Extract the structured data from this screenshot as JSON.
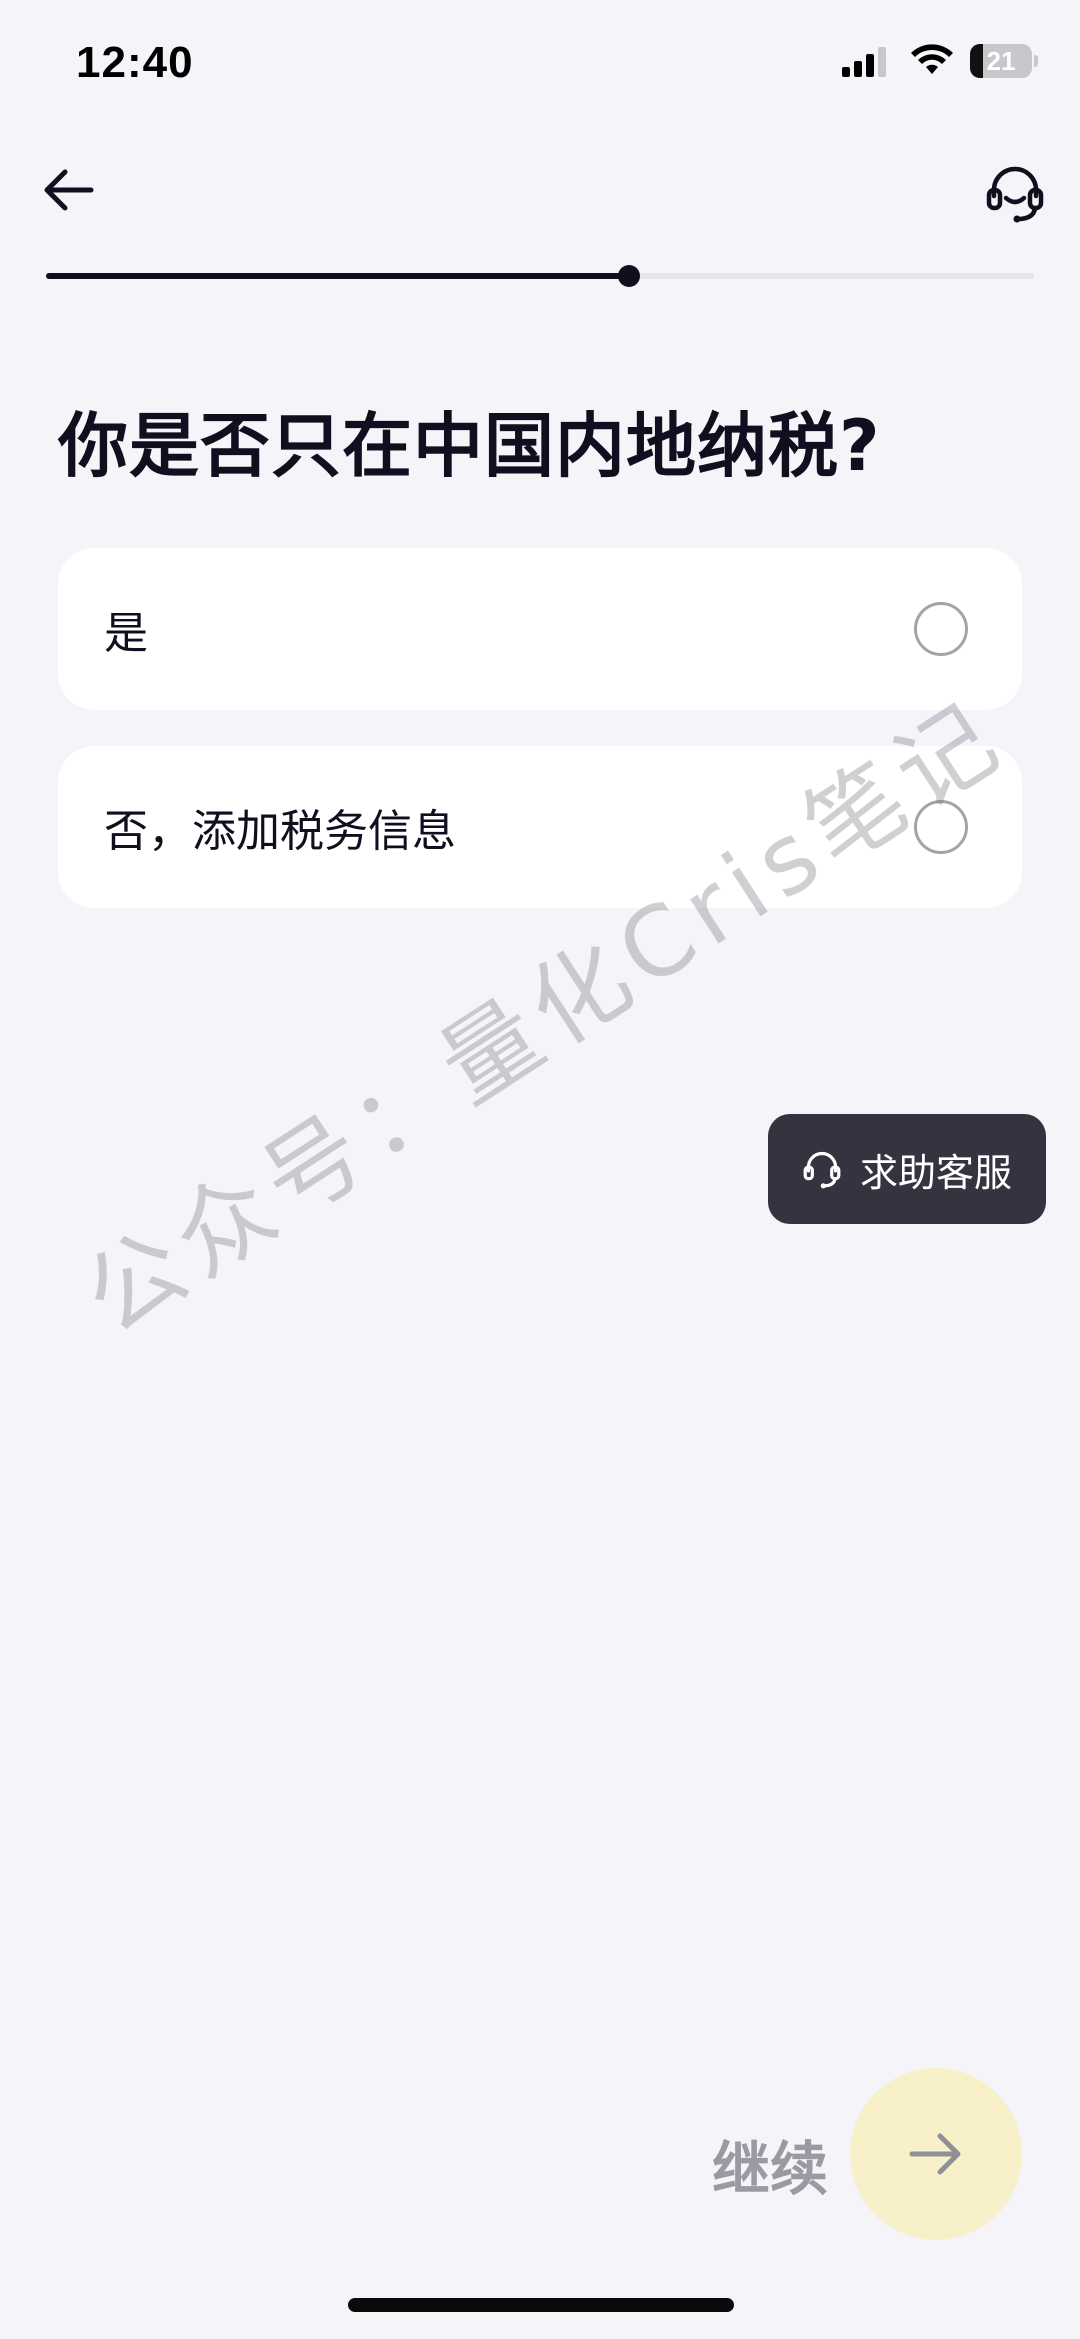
{
  "status_bar": {
    "time": "12:40",
    "battery": "21",
    "battery_level": 0.21
  },
  "nav": {
    "back_icon": "arrow-left-icon",
    "support_icon": "headset-icon"
  },
  "progress": {
    "value": 0.59
  },
  "question": {
    "title": "你是否只在中国内地纳税?"
  },
  "options": [
    {
      "label": "是",
      "selected": false
    },
    {
      "label": "否，添加税务信息",
      "selected": false
    }
  ],
  "help": {
    "label": "求助客服",
    "icon": "headset-icon"
  },
  "watermark": "公众号：量化Cris笔记",
  "footer": {
    "continue_label": "继续",
    "continue_icon": "arrow-right-icon"
  },
  "colors": {
    "background": "#f4f4f9",
    "primary_text": "#0f0f1f",
    "help_button_bg": "#33343f",
    "continue_button_bg": "#f7f0c8"
  }
}
